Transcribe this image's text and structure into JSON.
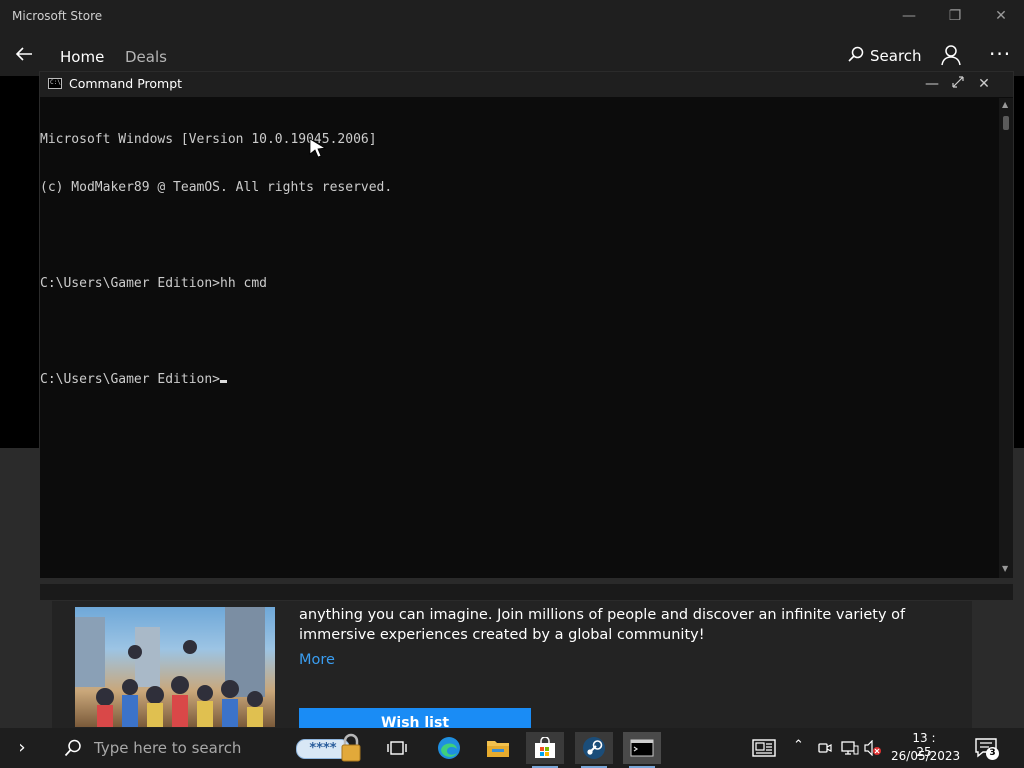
{
  "store": {
    "window_title": "Microsoft Store",
    "nav": {
      "home": "Home",
      "deals": "Deals",
      "search": "Search"
    },
    "description": "anything you can imagine. Join millions of people and discover an infinite variety of immersive experiences created by a global community!",
    "more_link": "More",
    "wishlist": "Wish list"
  },
  "cmd": {
    "title": "Command Prompt",
    "icon_glyph": "C:\\",
    "lines": [
      "Microsoft Windows [Version 10.0.19045.2006]",
      "(c) ModMaker89 @ TeamOS. All rights reserved.",
      "",
      "C:\\Users\\Gamer Edition>hh cmd",
      "",
      "C:\\Users\\Gamer Edition>"
    ]
  },
  "taskbar": {
    "search_placeholder": "Type here to search",
    "password_dots": "****",
    "time": "13 : 25",
    "date": "26/05/2023",
    "notification_count": "3"
  },
  "colors": {
    "accent_blue": "#1a8cf5",
    "link_blue": "#3a9df0",
    "cmd_text": "#cccccc"
  },
  "icons": [
    "back-arrow-icon",
    "search-icon",
    "account-icon",
    "more-icon",
    "cmd-icon",
    "start-chevron-icon",
    "password-lock-icon",
    "task-view-icon",
    "edge-icon",
    "file-explorer-icon",
    "store-icon",
    "steam-icon",
    "terminal-icon",
    "news-icon",
    "tray-chevron-icon",
    "meet-now-icon",
    "network-icon",
    "volume-muted-icon",
    "notification-icon"
  ]
}
